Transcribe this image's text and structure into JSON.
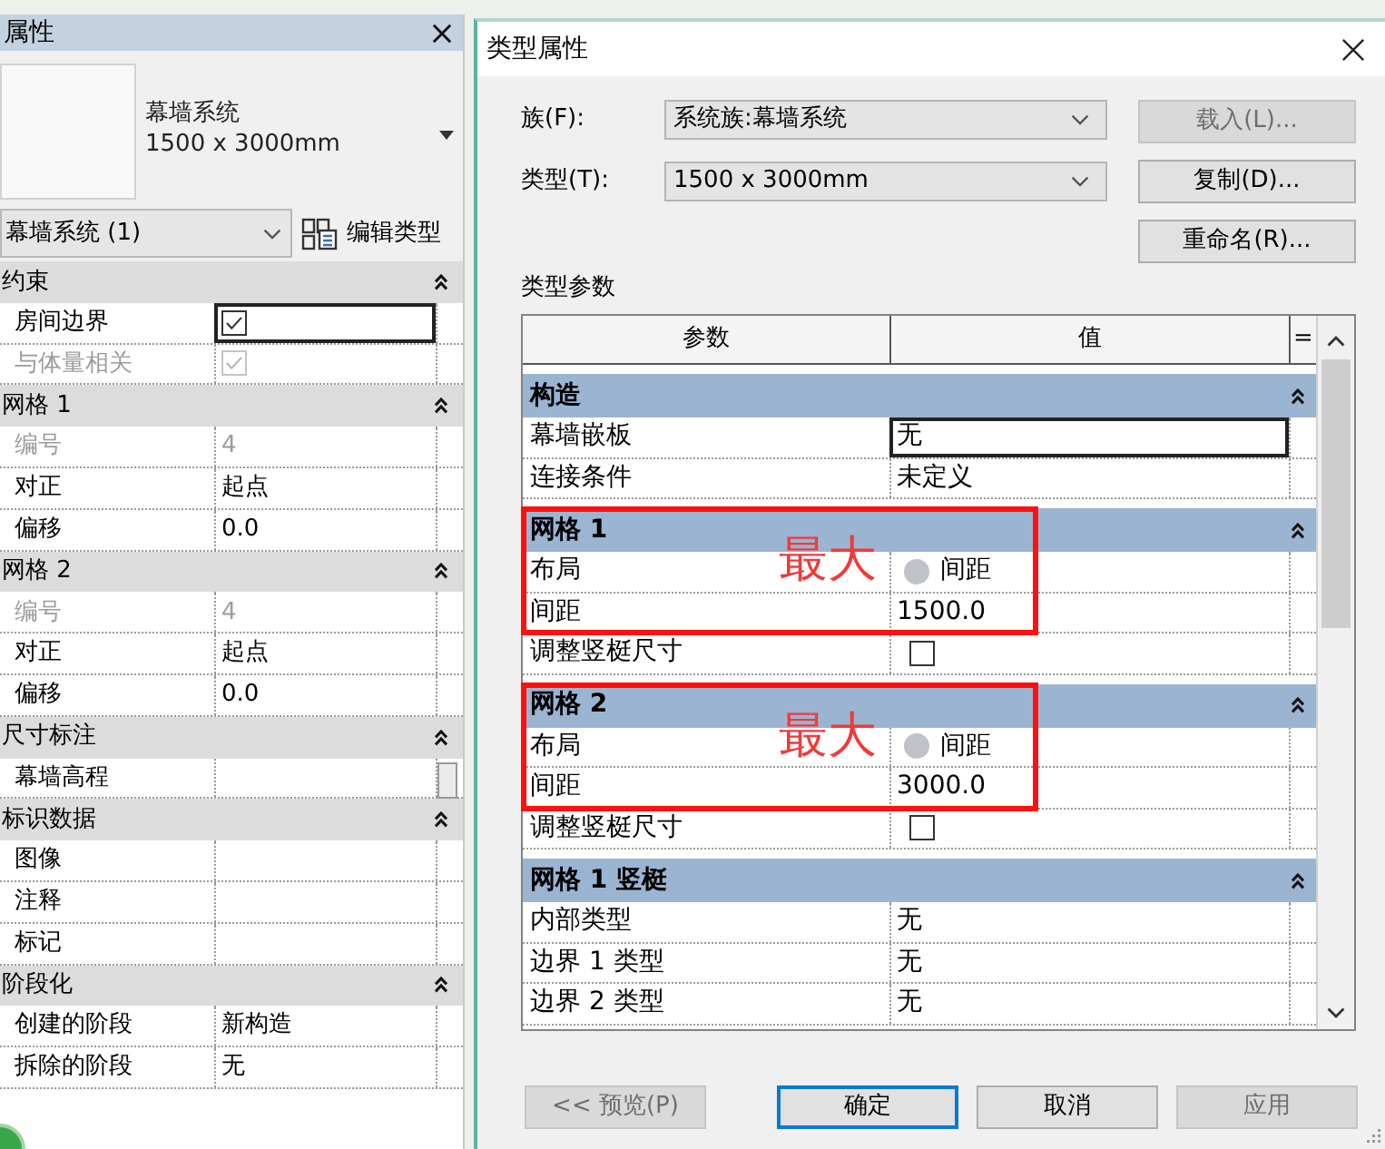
{
  "properties_panel": {
    "title": "属性",
    "type_preview": {
      "family": "幕墙系统",
      "type": "1500 x 3000mm"
    },
    "instance_filter": {
      "value": "幕墙系统 (1)"
    },
    "edit_type_button": {
      "label": "编辑类型"
    },
    "groups": [
      {
        "title": "约束",
        "expanded": true,
        "rows": [
          {
            "name": "房间边界",
            "kind": "checkbox",
            "checked": true,
            "disabled": false,
            "selected": true
          },
          {
            "name": "与体量相关",
            "kind": "checkbox",
            "checked": true,
            "disabled": true,
            "selected": false
          }
        ]
      },
      {
        "title": "网格 1",
        "expanded": true,
        "rows": [
          {
            "name": "编号",
            "kind": "text",
            "value": "4",
            "disabled": true,
            "selected": false
          },
          {
            "name": "对正",
            "kind": "text",
            "value": "起点",
            "disabled": false,
            "selected": false
          },
          {
            "name": "偏移",
            "kind": "text",
            "value": "0.0",
            "disabled": false,
            "selected": false
          }
        ]
      },
      {
        "title": "网格 2",
        "expanded": true,
        "rows": [
          {
            "name": "编号",
            "kind": "text",
            "value": "4",
            "disabled": true,
            "selected": false
          },
          {
            "name": "对正",
            "kind": "text",
            "value": "起点",
            "disabled": false,
            "selected": false
          },
          {
            "name": "偏移",
            "kind": "text",
            "value": "0.0",
            "disabled": false,
            "selected": false
          }
        ]
      },
      {
        "title": "尺寸标注",
        "expanded": true,
        "rows": [
          {
            "name": "幕墙高程",
            "kind": "text",
            "disabled": false,
            "selected": false
          }
        ]
      },
      {
        "title": "标识数据",
        "expanded": true,
        "rows": [
          {
            "name": "图像",
            "kind": "text",
            "disabled": false,
            "selected": false
          },
          {
            "name": "注释",
            "kind": "text",
            "disabled": false,
            "selected": false
          },
          {
            "name": "标记",
            "kind": "text",
            "disabled": false,
            "selected": false
          }
        ]
      },
      {
        "title": "阶段化",
        "expanded": true,
        "rows": [
          {
            "name": "创建的阶段",
            "kind": "text",
            "value": "新构造",
            "disabled": false,
            "selected": false
          },
          {
            "name": "拆除的阶段",
            "kind": "text",
            "value": "无",
            "disabled": false,
            "selected": false
          }
        ]
      }
    ]
  },
  "type_properties_dialog": {
    "title": "类型属性",
    "family": {
      "label": "族(F):",
      "value": "系统族:幕墙系统"
    },
    "type": {
      "label": "类型(T):",
      "value": "1500 x 3000mm"
    },
    "side_buttons": [
      {
        "label": "载入(L)...",
        "disabled": true
      },
      {
        "label": "复制(D)...",
        "disabled": false
      },
      {
        "label": "重命名(R)...",
        "disabled": false
      }
    ],
    "parameters_label": "类型参数",
    "table": {
      "columns": [
        "参数",
        "值",
        "="
      ],
      "groups": [
        {
          "title": "构造",
          "expanded": true,
          "rows": [
            {
              "name": "幕墙嵌板",
              "kind": "text",
              "value": "无",
              "selected": true,
              "obscured": false
            },
            {
              "name": "连接条件",
              "kind": "text",
              "value": "未定义",
              "selected": false,
              "obscured": false
            }
          ]
        },
        {
          "title": "网格 1",
          "expanded": true,
          "annotation": "最大",
          "rows": [
            {
              "name": "布局",
              "kind": "text",
              "value": "间距",
              "selected": false,
              "obscured": true
            },
            {
              "name": "间距",
              "kind": "text",
              "value": "1500.0",
              "selected": false,
              "obscured": false
            },
            {
              "name": "调整竖梃尺寸",
              "kind": "checkbox",
              "checked": false,
              "selected": false,
              "obscured": false
            }
          ]
        },
        {
          "title": "网格 2",
          "expanded": true,
          "annotation": "最大",
          "rows": [
            {
              "name": "布局",
              "kind": "text",
              "value": "间距",
              "selected": false,
              "obscured": true
            },
            {
              "name": "间距",
              "kind": "text",
              "value": "3000.0",
              "selected": false,
              "obscured": false
            },
            {
              "name": "调整竖梃尺寸",
              "kind": "checkbox",
              "checked": false,
              "selected": false,
              "obscured": false
            }
          ]
        },
        {
          "title": "网格 1 竖梃",
          "expanded": true,
          "rows": [
            {
              "name": "内部类型",
              "kind": "text",
              "value": "无",
              "selected": false,
              "obscured": false
            },
            {
              "name": "边界 1 类型",
              "kind": "text",
              "value": "无",
              "selected": false,
              "obscured": false
            },
            {
              "name": "边界 2 类型",
              "kind": "text",
              "value": "无",
              "selected": false,
              "obscured": false
            }
          ]
        }
      ]
    },
    "buttons": [
      {
        "label": "<< 预览(P)",
        "disabled": true,
        "default": false
      },
      {
        "label": "确定",
        "disabled": false,
        "default": true
      },
      {
        "label": "取消",
        "disabled": false,
        "default": false
      },
      {
        "label": "应用",
        "disabled": true,
        "default": false
      }
    ]
  }
}
